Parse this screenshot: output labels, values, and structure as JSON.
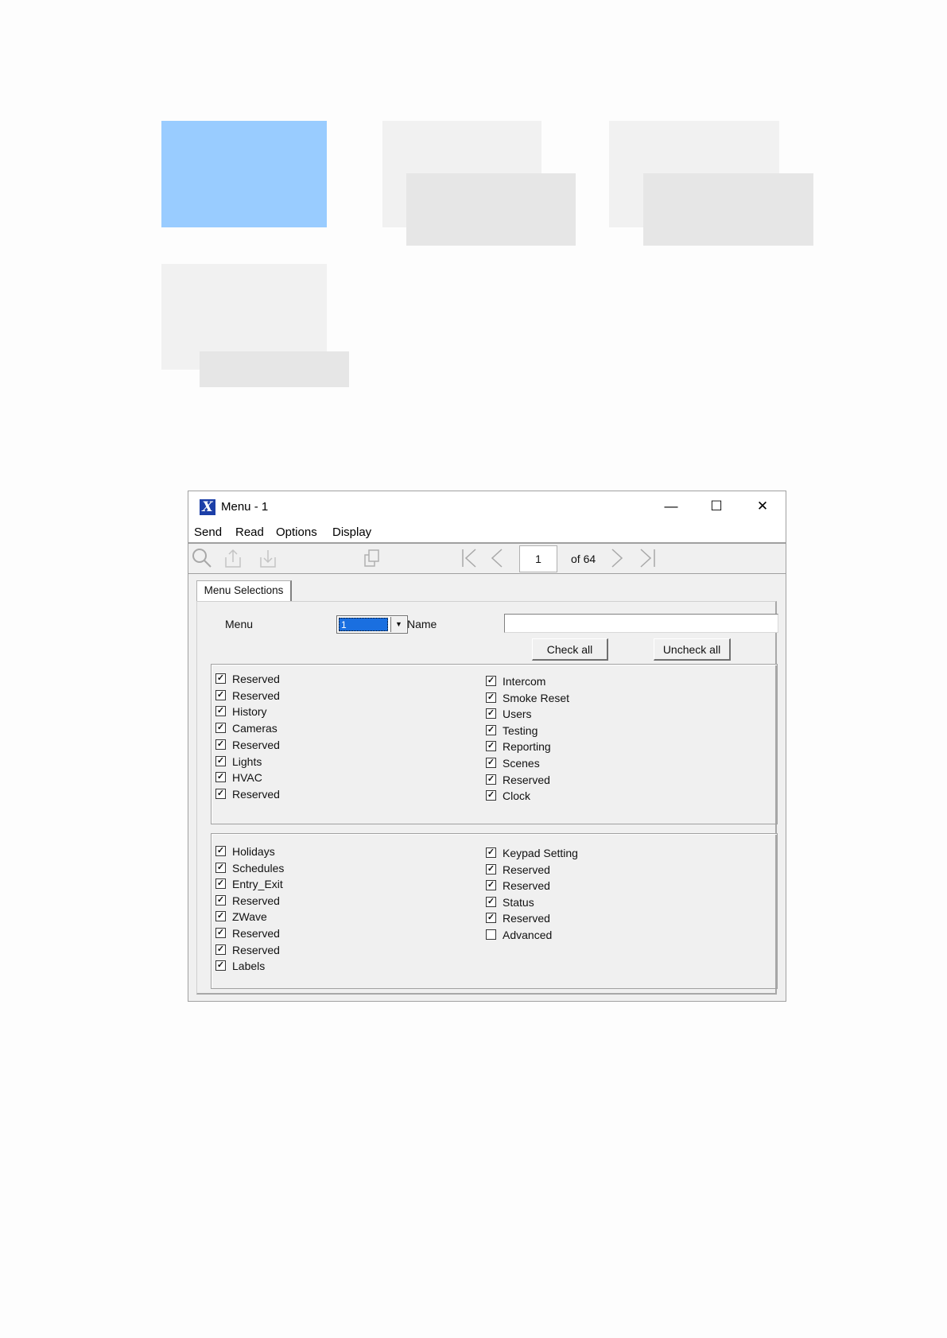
{
  "window": {
    "title": "Menu - 1",
    "icon": "x-app-icon",
    "controls": {
      "minimize": "—",
      "maximize": "☐",
      "close": "✕"
    }
  },
  "menubar": {
    "items": [
      "Send",
      "Read",
      "Options",
      "Display"
    ]
  },
  "toolbar": {
    "icons": [
      "search-icon",
      "upload-icon",
      "download-icon",
      "copy-icon",
      "first-page-icon",
      "prev-page-icon",
      "next-page-icon",
      "last-page-icon"
    ],
    "page_value": "1",
    "page_of": "of 64"
  },
  "tab": {
    "label": "Menu Selections"
  },
  "form": {
    "menu_label": "Menu",
    "menu_value": "1",
    "name_label": "Name",
    "name_value": "",
    "check_all": "Check all",
    "uncheck_all": "Uncheck all"
  },
  "group1": {
    "left": [
      {
        "label": "Reserved",
        "checked": true
      },
      {
        "label": "Reserved",
        "checked": true
      },
      {
        "label": "History",
        "checked": true
      },
      {
        "label": "Cameras",
        "checked": true
      },
      {
        "label": "Reserved",
        "checked": true
      },
      {
        "label": "Lights",
        "checked": true
      },
      {
        "label": "HVAC",
        "checked": true
      },
      {
        "label": "Reserved",
        "checked": true
      }
    ],
    "right": [
      {
        "label": "Intercom",
        "checked": true
      },
      {
        "label": "Smoke Reset",
        "checked": true
      },
      {
        "label": "Users",
        "checked": true
      },
      {
        "label": "Testing",
        "checked": true
      },
      {
        "label": "Reporting",
        "checked": true
      },
      {
        "label": "Scenes",
        "checked": true
      },
      {
        "label": "Reserved",
        "checked": true
      },
      {
        "label": "Clock",
        "checked": true
      }
    ]
  },
  "group2": {
    "left": [
      {
        "label": "Holidays",
        "checked": true
      },
      {
        "label": "Schedules",
        "checked": true
      },
      {
        "label": "Entry_Exit",
        "checked": true
      },
      {
        "label": "Reserved",
        "checked": true
      },
      {
        "label": "ZWave",
        "checked": true
      },
      {
        "label": "Reserved",
        "checked": true
      },
      {
        "label": "Reserved",
        "checked": true
      },
      {
        "label": "Labels",
        "checked": true
      }
    ],
    "right": [
      {
        "label": "Keypad Setting",
        "checked": true
      },
      {
        "label": "Reserved",
        "checked": true
      },
      {
        "label": "Reserved",
        "checked": true
      },
      {
        "label": "Status",
        "checked": true
      },
      {
        "label": "Reserved",
        "checked": true
      },
      {
        "label": "Advanced",
        "checked": false
      }
    ]
  },
  "colors": {
    "highlight_block": "#99ccff",
    "selection": "#1a6fe0",
    "window_bg": "#f0f0f0"
  }
}
